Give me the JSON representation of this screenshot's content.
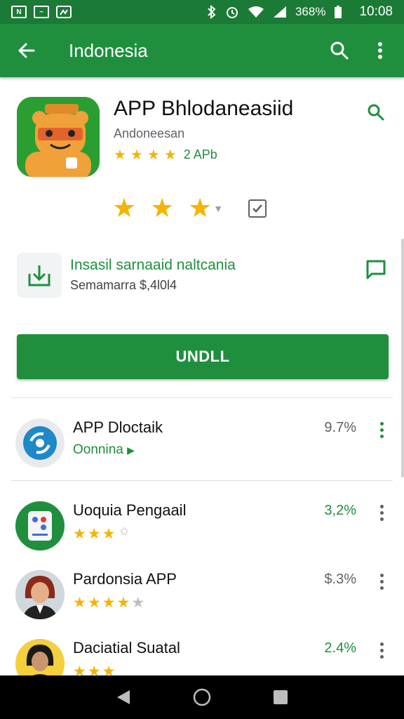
{
  "status_bar": {
    "notif1": "N",
    "notif2": "~",
    "battery": "368%",
    "time": "10:08"
  },
  "app_bar": {
    "title": "Indonesia",
    "icons": [
      "arrow-back-icon",
      "search-icon",
      "more-vert-icon"
    ]
  },
  "app": {
    "title": "APP Bhlodaneasiid",
    "publisher": "Andoneesan",
    "rating_count": "2 APb",
    "rating_stars": 3.5,
    "big_rating_stars": 2.5,
    "accent_color": "#1f8f3e"
  },
  "install_info": {
    "title": "Insasil sarnaaid naltcania",
    "subtitle": "Semamarra $,4l0l4"
  },
  "install_button": {
    "label": "UNDLL"
  },
  "list": [
    {
      "title": "APP Dloctaik",
      "subtitle": "Oonnina",
      "percent": "9.7%",
      "stars": null
    },
    {
      "title": "Uoquia Pengaail",
      "subtitle": "",
      "percent": "3,2%",
      "stars": 3
    },
    {
      "title": "Pardonsia APP",
      "subtitle": "",
      "percent": "$.3%",
      "stars": 3.5
    },
    {
      "title": "Daciatial Suatal",
      "subtitle": "",
      "percent": "2.4%",
      "stars": 3
    }
  ]
}
